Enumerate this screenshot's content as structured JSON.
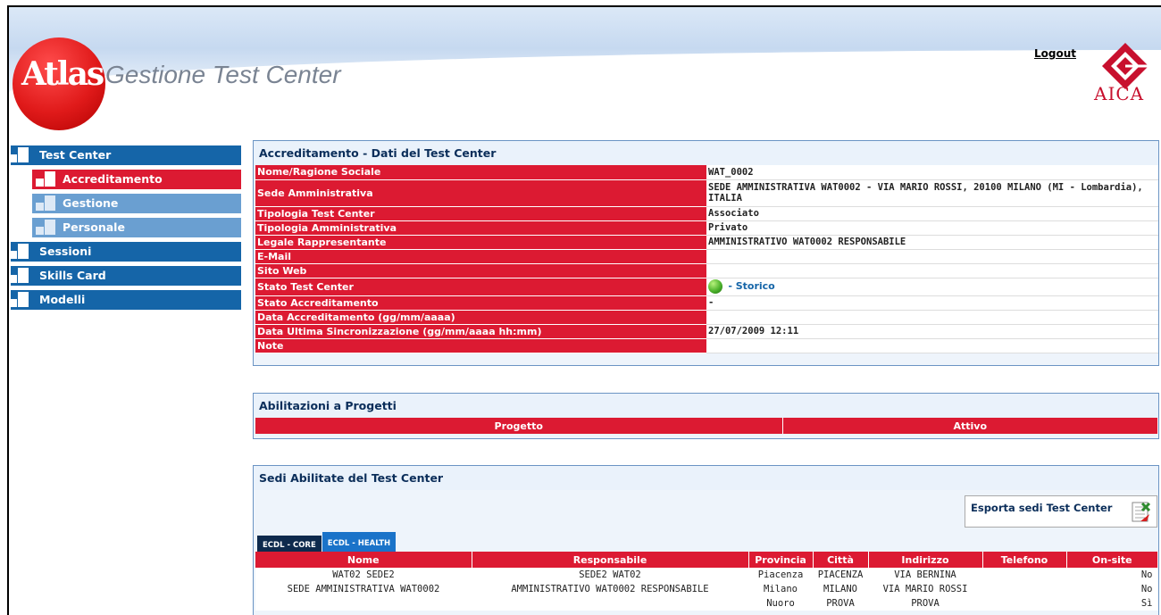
{
  "header": {
    "logo_text": "Atlas",
    "app_title": "Gestione Test Center",
    "logout_label": "Logout",
    "partner_logo": "AICA"
  },
  "nav": {
    "items": [
      {
        "label": "Test Center",
        "kind": "top"
      },
      {
        "label": "Accreditamento",
        "kind": "active"
      },
      {
        "label": "Gestione",
        "kind": "sub"
      },
      {
        "label": "Personale",
        "kind": "sub"
      },
      {
        "label": "Sessioni",
        "kind": "top"
      },
      {
        "label": "Skills Card",
        "kind": "top"
      },
      {
        "label": "Modelli",
        "kind": "top"
      }
    ]
  },
  "details": {
    "title": "Accreditamento - Dati del Test Center",
    "rows": [
      {
        "label": "Nome/Ragione Sociale",
        "value": "WAT_0002"
      },
      {
        "label": "Sede Amministrativa",
        "value": "SEDE AMMINISTRATIVA WAT0002 - VIA MARIO ROSSI, 20100 MILANO (MI - Lombardia), ITALIA"
      },
      {
        "label": "Tipologia Test Center",
        "value": "Associato"
      },
      {
        "label": "Tipologia Amministrativa",
        "value": "Privato"
      },
      {
        "label": "Legale Rappresentante",
        "value": "AMMINISTRATIVO WAT0002 RESPONSABILE"
      },
      {
        "label": "E-Mail",
        "value": ""
      },
      {
        "label": "Sito Web",
        "value": ""
      },
      {
        "label": "Stato Test Center",
        "value": "- Storico"
      },
      {
        "label": "Stato Accreditamento",
        "value": "-"
      },
      {
        "label": "Data Accreditamento (gg/mm/aaaa)",
        "value": ""
      },
      {
        "label": "Data Ultima Sincronizzazione (gg/mm/aaaa hh:mm)",
        "value": "27/07/2009 12:11"
      },
      {
        "label": "Note",
        "value": ""
      }
    ]
  },
  "projects": {
    "title": "Abilitazioni a Progetti",
    "columns": [
      "Progetto",
      "Attivo"
    ]
  },
  "sedi": {
    "title": "Sedi Abilitate del Test Center",
    "export_label": "Esporta sedi Test Center",
    "tabs": [
      "ECDL - CORE",
      "ECDL - HEALTH"
    ],
    "columns": [
      "Nome",
      "Responsabile",
      "Provincia",
      "Città",
      "Indirizzo",
      "Telefono",
      "On-site"
    ],
    "rows": [
      [
        "WAT02 SEDE2",
        "SEDE2 WAT02",
        "Piacenza",
        "PIACENZA",
        "VIA BERNINA",
        "",
        "No"
      ],
      [
        "SEDE AMMINISTRATIVA WAT0002",
        "AMMINISTRATIVO WAT0002 RESPONSABILE",
        "Milano",
        "MILANO",
        "VIA MARIO ROSSI",
        "",
        "No"
      ],
      [
        "",
        "",
        "Nuoro",
        "PROVA",
        "PROVA",
        "",
        "Sì"
      ]
    ]
  },
  "colors": {
    "accent_red": "#dc1a32",
    "nav_blue": "#1565a8",
    "nav_sub_blue": "#6a9fd1",
    "status_green": "#4cb12b"
  }
}
